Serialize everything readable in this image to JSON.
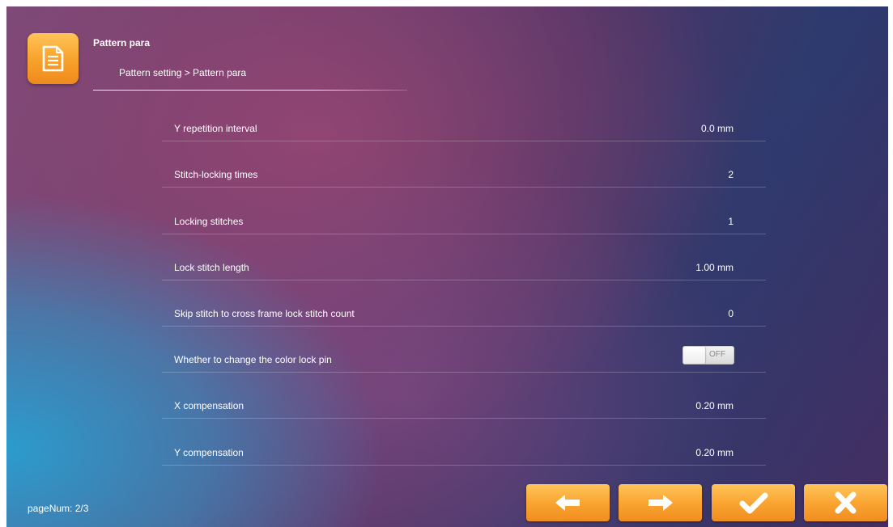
{
  "header": {
    "title": "Pattern para",
    "breadcrumb": "Pattern setting > Pattern para",
    "icon": "document-icon"
  },
  "params": [
    {
      "label": "Y repetition interval",
      "value": "0.0 mm"
    },
    {
      "label": "Stitch-locking times",
      "value": "2"
    },
    {
      "label": "Locking stitches",
      "value": "1"
    },
    {
      "label": "Lock stitch length",
      "value": "1.00 mm"
    },
    {
      "label": "Skip stitch to cross frame lock stitch count",
      "value": "0"
    },
    {
      "label": "Whether to change the color lock pin",
      "toggle": "OFF"
    },
    {
      "label": "X compensation",
      "value": "0.20 mm"
    },
    {
      "label": "Y compensation",
      "value": "0.20 mm"
    }
  ],
  "footer": {
    "page_num": "pageNum: 2/3",
    "buttons": [
      "arrow-left-icon",
      "arrow-right-icon",
      "checkmark-icon",
      "close-icon"
    ]
  },
  "colors": {
    "accent": "#f9a22f",
    "text": "#ffffff"
  }
}
